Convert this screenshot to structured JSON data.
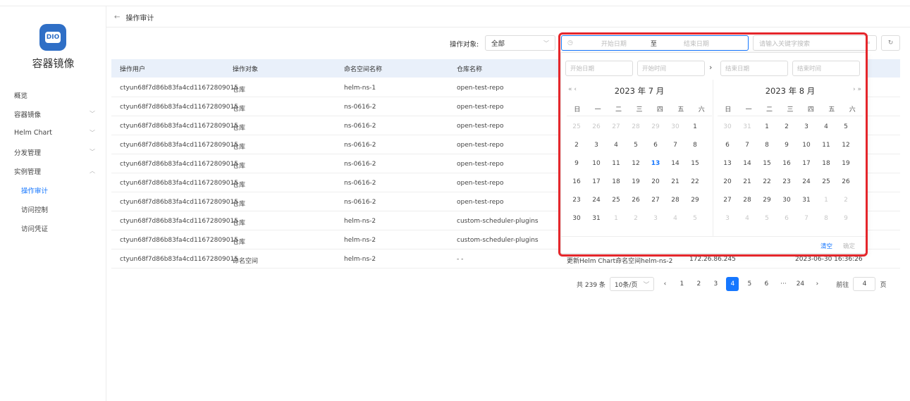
{
  "sidebar": {
    "app_name": "容器镜像",
    "menu": [
      {
        "label": "概览"
      },
      {
        "label": "容器镜像"
      },
      {
        "label": "Helm Chart"
      },
      {
        "label": "分发管理"
      },
      {
        "label": "实例管理"
      },
      {
        "label": "操作审计"
      },
      {
        "label": "访问控制"
      },
      {
        "label": "访问凭证"
      }
    ]
  },
  "header": {
    "back": "←",
    "title": "操作审计"
  },
  "filters": {
    "object_label": "操作对象:",
    "object_value": "全部",
    "start_placeholder": "开始日期",
    "to": "至",
    "end_placeholder": "结束日期",
    "keyword_placeholder": "请输入关键字搜索"
  },
  "table": {
    "headers": [
      "操作用户",
      "操作对象",
      "命名空间名称",
      "仓库名称"
    ],
    "rows": [
      [
        "ctyun68f7d86b83fa4cd11672809015",
        "仓库",
        "helm-ns-1",
        "open-test-repo"
      ],
      [
        "ctyun68f7d86b83fa4cd11672809015",
        "仓库",
        "ns-0616-2",
        "open-test-repo"
      ],
      [
        "ctyun68f7d86b83fa4cd11672809015",
        "仓库",
        "ns-0616-2",
        "open-test-repo"
      ],
      [
        "ctyun68f7d86b83fa4cd11672809015",
        "仓库",
        "ns-0616-2",
        "open-test-repo"
      ],
      [
        "ctyun68f7d86b83fa4cd11672809015",
        "仓库",
        "ns-0616-2",
        "open-test-repo"
      ],
      [
        "ctyun68f7d86b83fa4cd11672809015",
        "仓库",
        "ns-0616-2",
        "open-test-repo"
      ],
      [
        "ctyun68f7d86b83fa4cd11672809015",
        "仓库",
        "ns-0616-2",
        "open-test-repo"
      ],
      [
        "ctyun68f7d86b83fa4cd11672809015",
        "仓库",
        "helm-ns-2",
        "custom-scheduler-plugins"
      ],
      [
        "ctyun68f7d86b83fa4cd11672809015",
        "仓库",
        "helm-ns-2",
        "custom-scheduler-plugins"
      ],
      [
        "ctyun68f7d86b83fa4cd11672809015",
        "命名空间",
        "helm-ns-2",
        "- -",
        "更新Helm Chart命名空间helm-ns-2",
        "172.26.86.245",
        "2023-06-30 16:36:26"
      ]
    ]
  },
  "pager": {
    "total": "共 239 条",
    "page_size": "10条/页",
    "pages": [
      "1",
      "2",
      "3",
      "4",
      "5",
      "6",
      "···",
      "24"
    ],
    "current": "4",
    "goto_label": "前往",
    "goto_value": "4",
    "goto_unit": "页"
  },
  "picker": {
    "start_date": "开始日期",
    "start_time": "开始时间",
    "end_date": "结束日期",
    "end_time": "结束时间",
    "left_title": "2023 年 7 月",
    "right_title": "2023 年 8 月",
    "weekdays": [
      "日",
      "一",
      "二",
      "三",
      "四",
      "五",
      "六"
    ],
    "left_days": [
      "25",
      "26",
      "27",
      "28",
      "29",
      "30",
      "1",
      "2",
      "3",
      "4",
      "5",
      "6",
      "7",
      "8",
      "9",
      "10",
      "11",
      "12",
      "13",
      "14",
      "15",
      "16",
      "17",
      "18",
      "19",
      "20",
      "21",
      "22",
      "23",
      "24",
      "25",
      "26",
      "27",
      "28",
      "29",
      "30",
      "31",
      "1",
      "2",
      "3",
      "4",
      "5"
    ],
    "right_days": [
      "30",
      "31",
      "1",
      "2",
      "3",
      "4",
      "5",
      "6",
      "7",
      "8",
      "9",
      "10",
      "11",
      "12",
      "13",
      "14",
      "15",
      "16",
      "17",
      "18",
      "19",
      "20",
      "21",
      "22",
      "23",
      "24",
      "25",
      "26",
      "27",
      "28",
      "29",
      "30",
      "31",
      "1",
      "2",
      "3",
      "4",
      "5",
      "6",
      "7",
      "8",
      "9"
    ],
    "today": "13",
    "clear": "清空",
    "confirm": "确定"
  },
  "colors": {
    "accent": "#1677ff",
    "highlight": "#e5262b",
    "logo": "#2f6fc6"
  }
}
